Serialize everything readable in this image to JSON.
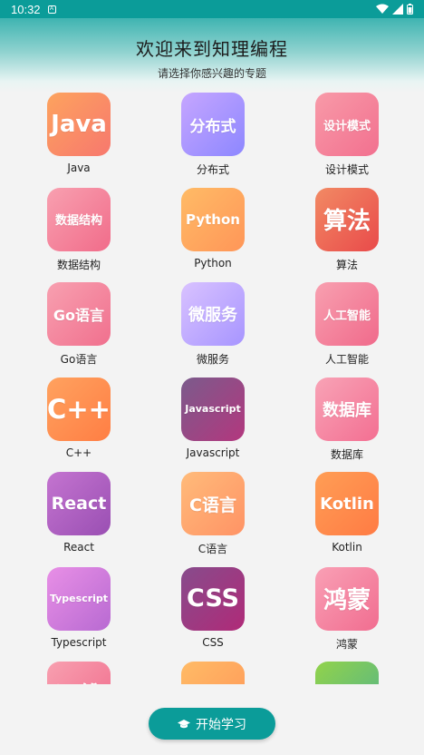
{
  "status_bar": {
    "time": "10:32"
  },
  "header": {
    "title": "欢迎来到知理编程",
    "subtitle": "请选择你感兴趣的专题"
  },
  "topics": [
    {
      "tile_text": "Java",
      "label": "Java",
      "c1": "#fda35e",
      "c2": "#f7786e",
      "fs": 26
    },
    {
      "tile_text": "分布式",
      "label": "分布式",
      "c1": "#c6a6ff",
      "c2": "#8d87ff",
      "fs": 17
    },
    {
      "tile_text": "设计模式",
      "label": "设计模式",
      "c1": "#f89aa8",
      "c2": "#f2708f",
      "fs": 13
    },
    {
      "tile_text": "数据结构",
      "label": "数据结构",
      "c1": "#f8a0b0",
      "c2": "#f16c8a",
      "fs": 13
    },
    {
      "tile_text": "Python",
      "label": "Python",
      "c1": "#ffbb66",
      "c2": "#ff9658",
      "fs": 15
    },
    {
      "tile_text": "算法",
      "label": "算法",
      "c1": "#f28a64",
      "c2": "#e94a4a",
      "fs": 26
    },
    {
      "tile_text": "Go语言",
      "label": "Go语言",
      "c1": "#f8a0b0",
      "c2": "#f0708e",
      "fs": 16
    },
    {
      "tile_text": "微服务",
      "label": "微服务",
      "c1": "#d9c2ff",
      "c2": "#a795ff",
      "fs": 18
    },
    {
      "tile_text": "人工智能",
      "label": "人工智能",
      "c1": "#f8a0b0",
      "c2": "#f06a8b",
      "fs": 13
    },
    {
      "tile_text": "C++",
      "label": "C++",
      "c1": "#ffa25f",
      "c2": "#ff7e44",
      "fs": 29
    },
    {
      "tile_text": "Javascript",
      "label": "Javascript",
      "c1": "#7b5b8c",
      "c2": "#b3377e",
      "fs": 11
    },
    {
      "tile_text": "数据库",
      "label": "数据库",
      "c1": "#f8a3b6",
      "c2": "#f36f92",
      "fs": 18
    },
    {
      "tile_text": "React",
      "label": "React",
      "c1": "#c474d0",
      "c2": "#9a4fb3",
      "fs": 19
    },
    {
      "tile_text": "C语言",
      "label": "C语言",
      "c1": "#ffbb7a",
      "c2": "#ff9365",
      "fs": 19
    },
    {
      "tile_text": "Kotlin",
      "label": "Kotlin",
      "c1": "#ff9e55",
      "c2": "#ff7b44",
      "fs": 18
    },
    {
      "tile_text": "Typescript",
      "label": "Typescript",
      "c1": "#e88fe6",
      "c2": "#b86ad2",
      "fs": 11
    },
    {
      "tile_text": "CSS",
      "label": "CSS",
      "c1": "#874c8c",
      "c2": "#b02a78",
      "fs": 27
    },
    {
      "tile_text": "鸿蒙",
      "label": "鸿蒙",
      "c1": "#f9a0b5",
      "c2": "#f16d90",
      "fs": 26
    },
    {
      "tile_text": "运维",
      "label": "",
      "c1": "#f8a0b0",
      "c2": "#f06a8b",
      "fs": 26
    },
    {
      "tile_text": "",
      "label": "",
      "c1": "#ffbb66",
      "c2": "#ff9658",
      "fs": 18
    },
    {
      "tile_text": "",
      "label": "",
      "c1": "#92d34a",
      "c2": "#52b38b",
      "fs": 18
    }
  ],
  "start_button": {
    "label": "开始学习"
  },
  "colors": {
    "accent": "#0b9c99"
  }
}
